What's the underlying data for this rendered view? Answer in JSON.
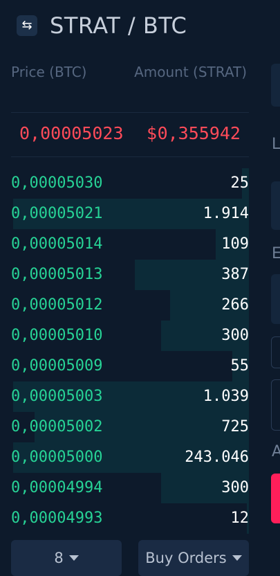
{
  "header": {
    "pair": "STRAT / BTC",
    "swap_icon": "swap-icon"
  },
  "columns": {
    "price": "Price (BTC)",
    "amount": "Amount (STRAT)"
  },
  "last_trade": {
    "price": "0,00005023",
    "currency_symbol": "$",
    "usd_value": "0,355942",
    "color": "#ff4b59"
  },
  "orders": [
    {
      "price": "0,00005030",
      "amount": "25",
      "depth": 0.03
    },
    {
      "price": "0,00005021",
      "amount": "1.914",
      "depth": 0.99
    },
    {
      "price": "0,00005014",
      "amount": "109",
      "depth": 0.14
    },
    {
      "price": "0,00005013",
      "amount": "387",
      "depth": 0.48
    },
    {
      "price": "0,00005012",
      "amount": "266",
      "depth": 0.33
    },
    {
      "price": "0,00005010",
      "amount": "300",
      "depth": 0.37
    },
    {
      "price": "0,00005009",
      "amount": "55",
      "depth": 0.07
    },
    {
      "price": "0,00005003",
      "amount": "1.039",
      "depth": 0.99
    },
    {
      "price": "0,00005002",
      "amount": "725",
      "depth": 0.9
    },
    {
      "price": "0,00005000",
      "amount": "243.046",
      "depth": 0.99
    },
    {
      "price": "0,00004994",
      "amount": "300",
      "depth": 0.37
    },
    {
      "price": "0,00004993",
      "amount": "12",
      "depth": 0.01
    }
  ],
  "controls": {
    "decimals": "8",
    "view": "Buy Orders"
  },
  "right_panel": {
    "label_1": "L",
    "label_2": "E",
    "label_3": "A"
  },
  "colors": {
    "background": "#0d1a2b",
    "buy": "#27d396",
    "sell": "#ff4b59",
    "depth_bar": "#0c2b38"
  }
}
